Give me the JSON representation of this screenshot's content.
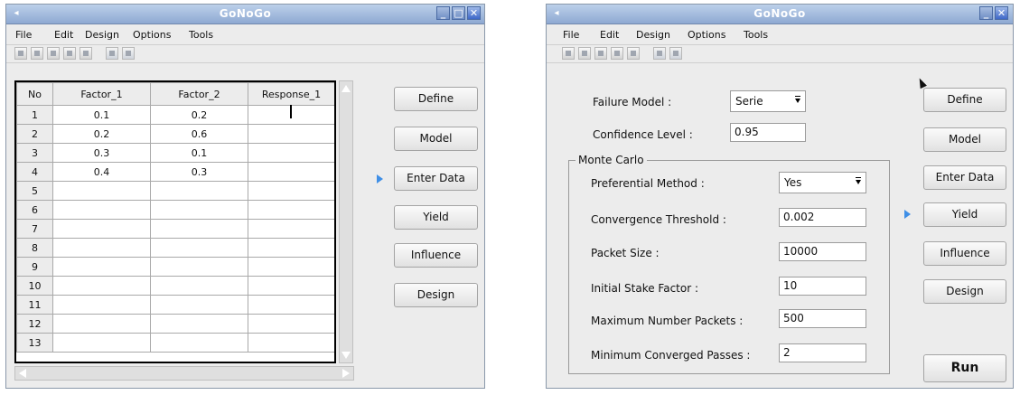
{
  "window1": {
    "title": "GoNoGo",
    "menu": [
      "File",
      "Edit",
      "Design",
      "Options",
      "Tools"
    ],
    "table": {
      "columns": [
        "No",
        "Factor_1",
        "Factor_2",
        "Response_1"
      ],
      "rows": [
        [
          "1",
          "0.1",
          "0.2",
          ""
        ],
        [
          "2",
          "0.2",
          "0.6",
          ""
        ],
        [
          "3",
          "0.3",
          "0.1",
          ""
        ],
        [
          "4",
          "0.4",
          "0.3",
          ""
        ],
        [
          "5",
          "",
          "",
          ""
        ],
        [
          "6",
          "",
          "",
          ""
        ],
        [
          "7",
          "",
          "",
          ""
        ],
        [
          "8",
          "",
          "",
          ""
        ],
        [
          "9",
          "",
          "",
          ""
        ],
        [
          "10",
          "",
          "",
          ""
        ],
        [
          "11",
          "",
          "",
          ""
        ],
        [
          "12",
          "",
          "",
          ""
        ],
        [
          "13",
          "",
          "",
          ""
        ]
      ]
    },
    "buttons": [
      "Define",
      "Model",
      "Enter Data",
      "Yield",
      "Influence",
      "Design"
    ],
    "active_button": "Enter Data"
  },
  "window2": {
    "title": "GoNoGo",
    "menu": [
      "File",
      "Edit",
      "Design",
      "Options",
      "Tools"
    ],
    "failure_model_label": "Failure Model :",
    "failure_model_value": "Serie",
    "confidence_label": "Confidence Level :",
    "confidence_value": "0.95",
    "monte_carlo_legend": "Monte Carlo",
    "preferential_label": "Preferential Method :",
    "preferential_value": "Yes",
    "fields": [
      {
        "label": "Convergence Threshold :",
        "value": "0.002"
      },
      {
        "label": "Packet Size :",
        "value": "10000"
      },
      {
        "label": "Initial Stake Factor :",
        "value": "10"
      },
      {
        "label": "Maximum Number Packets :",
        "value": "500"
      },
      {
        "label": "Minimum Converged Passes :",
        "value": "2"
      }
    ],
    "buttons": [
      "Define",
      "Model",
      "Enter Data",
      "Yield",
      "Influence",
      "Design"
    ],
    "active_button": "Yield",
    "run_label": "Run"
  },
  "colors": {
    "titlebar": "#8ea9d2",
    "indicator": "#3f8fe6",
    "window_bg": "#ececec"
  }
}
